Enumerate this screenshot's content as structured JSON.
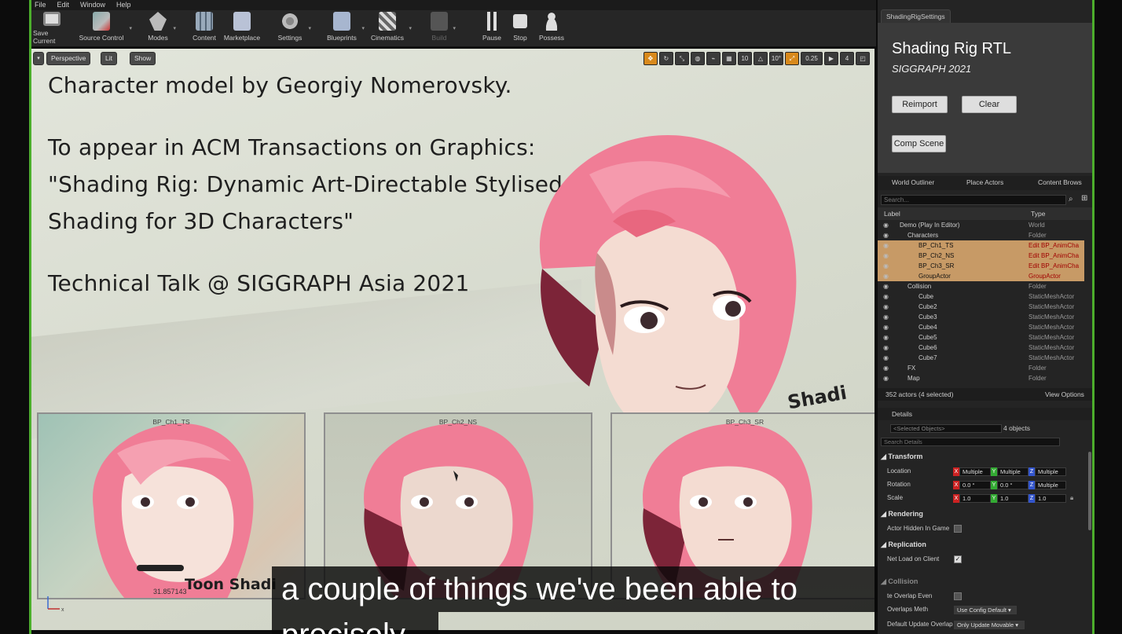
{
  "menu": [
    "File",
    "Edit",
    "Window",
    "Help"
  ],
  "toolbar": [
    {
      "label": "Save Current",
      "icon": "save-icon"
    },
    {
      "label": "Source Control",
      "icon": "source-control-icon"
    },
    {
      "label": "Modes",
      "icon": "modes-icon"
    },
    {
      "label": "Content",
      "icon": "content-icon"
    },
    {
      "label": "Marketplace",
      "icon": "marketplace-icon"
    },
    {
      "label": "Settings",
      "icon": "settings-icon"
    },
    {
      "label": "Blueprints",
      "icon": "blueprints-icon"
    },
    {
      "label": "Cinematics",
      "icon": "cinematics-icon"
    },
    {
      "label": "Build",
      "icon": "build-icon"
    },
    {
      "label": "Pause",
      "icon": "pause-icon"
    },
    {
      "label": "Stop",
      "icon": "stop-icon"
    },
    {
      "label": "Possess",
      "icon": "possess-icon"
    }
  ],
  "viewport": {
    "buttons": {
      "perspective": "Perspective",
      "lit": "Lit",
      "show": "Show"
    },
    "tools": {
      "grid": "10",
      "angle": "10°",
      "scale": "0.25",
      "speed": "4"
    },
    "text": {
      "line1": "Character model by Georgiy Nomerovsky.",
      "line2": "To appear in ACM Transactions on Graphics:",
      "line3": "\"Shading Rig: Dynamic Art-Directable Stylised",
      "line4": "Shading for 3D Characters\"",
      "line5": "Technical Talk @ SIGGRAPH Asia 2021"
    },
    "side_text": "Shadi",
    "thumbnails": [
      {
        "label": "BP_Ch1_TS",
        "overlay": "Toon Shadi",
        "coord": "31.857143"
      },
      {
        "label": "BP_Ch2_NS",
        "overlay": "",
        "coord": ""
      },
      {
        "label": "BP_Ch3_SR",
        "overlay": "",
        "coord": ""
      }
    ]
  },
  "caption": {
    "line1": "a couple of things we've been able to",
    "line2": "precisely"
  },
  "panel": {
    "tab": "ShadingRigSettings",
    "title": "Shading Rig RTL",
    "subtitle": "SIGGRAPH 2021",
    "buttons": {
      "reimport": "Reimport",
      "clear": "Clear",
      "comp_scene": "Comp Scene"
    }
  },
  "outliner": {
    "tabs": [
      "World Outliner",
      "Place Actors",
      "Content Brows"
    ],
    "search_placeholder": "Search...",
    "col_label": "Label",
    "col_type": "Type",
    "rows": [
      {
        "label": "Demo (Play In Editor)",
        "type": "World",
        "selected": false
      },
      {
        "label": "Characters",
        "type": "Folder",
        "selected": false
      },
      {
        "label": "BP_Ch1_TS",
        "type": "Edit BP_AnimCha",
        "selected": true
      },
      {
        "label": "BP_Ch2_NS",
        "type": "Edit BP_AnimCha",
        "selected": true
      },
      {
        "label": "BP_Ch3_SR",
        "type": "Edit BP_AnimCha",
        "selected": true
      },
      {
        "label": "GroupActor",
        "type": "GroupActor",
        "selected": true
      },
      {
        "label": "Collision",
        "type": "Folder",
        "selected": false
      },
      {
        "label": "Cube",
        "type": "StaticMeshActor",
        "selected": false
      },
      {
        "label": "Cube2",
        "type": "StaticMeshActor",
        "selected": false
      },
      {
        "label": "Cube3",
        "type": "StaticMeshActor",
        "selected": false
      },
      {
        "label": "Cube4",
        "type": "StaticMeshActor",
        "selected": false
      },
      {
        "label": "Cube5",
        "type": "StaticMeshActor",
        "selected": false
      },
      {
        "label": "Cube6",
        "type": "StaticMeshActor",
        "selected": false
      },
      {
        "label": "Cube7",
        "type": "StaticMeshActor",
        "selected": false
      },
      {
        "label": "FX",
        "type": "Folder",
        "selected": false
      },
      {
        "label": "Map",
        "type": "Folder",
        "selected": false
      }
    ],
    "footer": "352 actors (4 selected)",
    "view_options": "View Options"
  },
  "details": {
    "tab": "Details",
    "selected_placeholder": "<Selected Objects>",
    "count": "4 objects",
    "search_placeholder": "Search Details",
    "transform": "Transform",
    "location": "Location",
    "rotation": "Rotation",
    "scale": "Scale",
    "loc_values": [
      "Multiple",
      "Multiple",
      "Multiple"
    ],
    "rot_values": [
      "0.0 °",
      "0.0 °",
      "Multiple"
    ],
    "scale_values": [
      "1.0",
      "1.0",
      "1.0"
    ],
    "rendering": "Rendering",
    "actor_hidden": "Actor Hidden In Game",
    "replication": "Replication",
    "net_load": "Net Load on Client",
    "collision": "Collision",
    "overlap_events": "te Overlap Even",
    "overlaps_method": "Overlaps Meth",
    "overlaps_method_value": "Use Config Default",
    "default_update": "Default Update Overlap",
    "default_update_value": "Only Update Movable"
  }
}
